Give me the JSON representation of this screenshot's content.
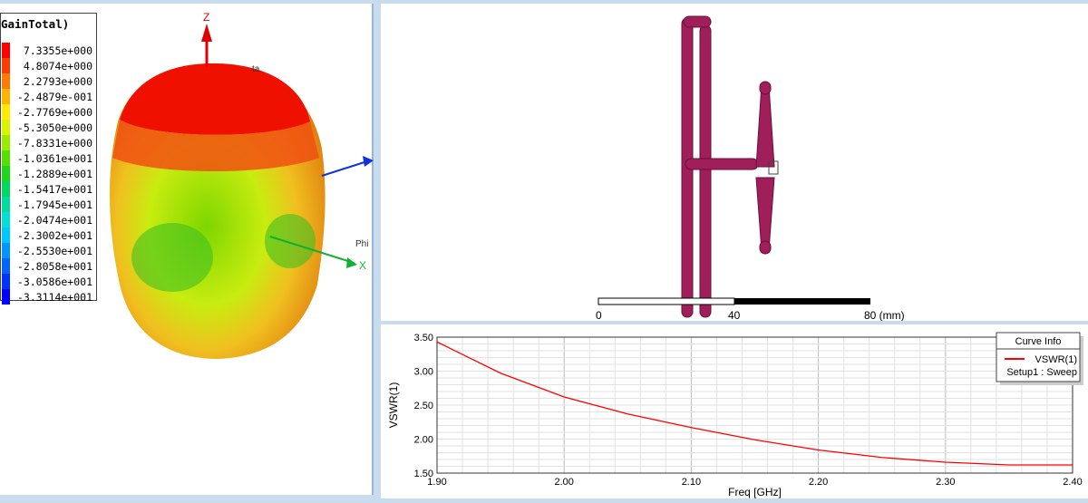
{
  "pattern_pane": {
    "legend_title": "GainTotal)",
    "legend": [
      {
        "value": "7.3355e+000",
        "color": "#ff0000"
      },
      {
        "value": "4.8074e+000",
        "color": "#ff3c00"
      },
      {
        "value": "2.2793e+000",
        "color": "#ff7a00"
      },
      {
        "value": "-2.4879e-001",
        "color": "#ffb400"
      },
      {
        "value": "-2.7769e+000",
        "color": "#ffea00"
      },
      {
        "value": "-5.3050e+000",
        "color": "#d8f500"
      },
      {
        "value": "-7.8331e+000",
        "color": "#9aeb00"
      },
      {
        "value": "-1.0361e+001",
        "color": "#55e000"
      },
      {
        "value": "-1.2889e+001",
        "color": "#1fd81a"
      },
      {
        "value": "-1.5417e+001",
        "color": "#00d860"
      },
      {
        "value": "-1.7945e+001",
        "color": "#00dca0"
      },
      {
        "value": "-2.0474e+001",
        "color": "#00e0d8"
      },
      {
        "value": "-2.3002e+001",
        "color": "#00c8ff"
      },
      {
        "value": "-2.5530e+001",
        "color": "#0096ff"
      },
      {
        "value": "-2.8058e+001",
        "color": "#0064ff"
      },
      {
        "value": "-3.0586e+001",
        "color": "#0032ff"
      },
      {
        "value": "-3.3114e+001",
        "color": "#0000ff"
      }
    ],
    "axis_z": "Z",
    "axis_x": "X",
    "label_phi": "Phi",
    "label_theta": "ta"
  },
  "model_pane": {
    "scale_labels": [
      "0",
      "40",
      "80 (mm)"
    ]
  },
  "chart_data": {
    "type": "line",
    "xlabel": "Freq [GHz]",
    "ylabel": "VSWR(1)",
    "xlim": [
      1.9,
      2.4
    ],
    "ylim": [
      1.5,
      3.5
    ],
    "xticks": [
      "1.90",
      "2.00",
      "2.10",
      "2.20",
      "2.30",
      "2.40"
    ],
    "yticks": [
      "3.50",
      "3.00",
      "2.50",
      "2.00",
      "1.50"
    ],
    "grid": true,
    "legend_title": "Curve Info",
    "legend_placement": "top-right",
    "series": [
      {
        "name": "VSWR(1)",
        "sub": "Setup1 : Sweep",
        "color": "#ff0000",
        "x": [
          1.9,
          1.95,
          2.0,
          2.05,
          2.1,
          2.15,
          2.2,
          2.25,
          2.3,
          2.35,
          2.4
        ],
        "y": [
          3.43,
          2.97,
          2.62,
          2.37,
          2.17,
          1.99,
          1.84,
          1.73,
          1.66,
          1.62,
          1.62
        ]
      }
    ]
  }
}
